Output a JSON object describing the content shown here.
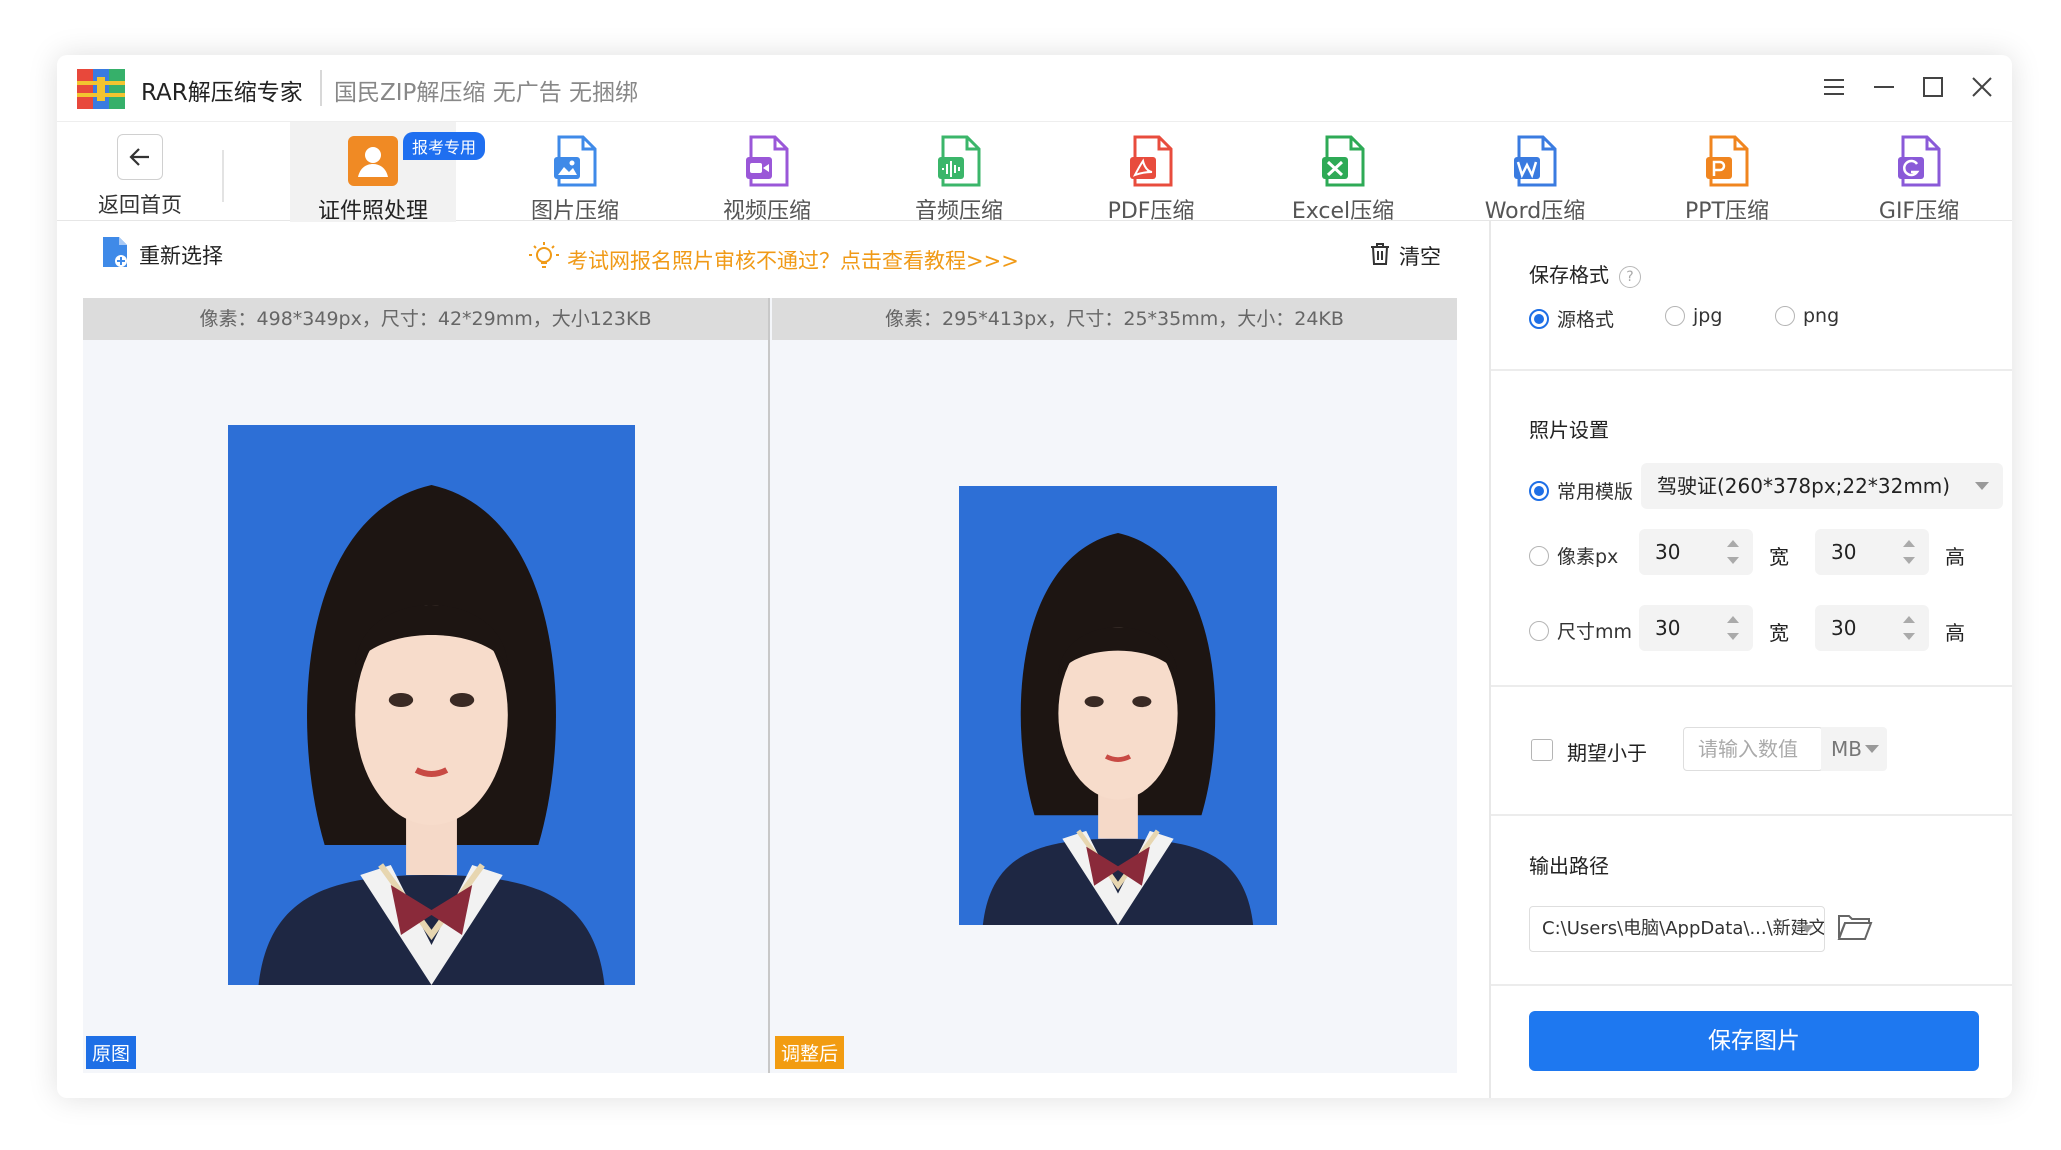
{
  "app": {
    "title": "RAR解压缩专家",
    "slogan": "国民ZIP解压缩  无广告 无捆绑"
  },
  "toolbar": {
    "back_label": "返回首页",
    "badge": "报考专用",
    "tools": [
      {
        "label": "证件照处理",
        "icon": "id-photo-icon",
        "color": "#f08a24",
        "active": true
      },
      {
        "label": "图片压缩",
        "icon": "image-file-icon",
        "color": "#3f8ae8"
      },
      {
        "label": "视频压缩",
        "icon": "video-file-icon",
        "color": "#9a57d8"
      },
      {
        "label": "音频压缩",
        "icon": "audio-file-icon",
        "color": "#3bb66a"
      },
      {
        "label": "PDF压缩",
        "icon": "pdf-file-icon",
        "color": "#e84c3d"
      },
      {
        "label": "Excel压缩",
        "icon": "excel-file-icon",
        "color": "#2eaa56"
      },
      {
        "label": "Word压缩",
        "icon": "word-file-icon",
        "color": "#3a7be0"
      },
      {
        "label": "PPT压缩",
        "icon": "ppt-file-icon",
        "color": "#f0851f"
      },
      {
        "label": "GIF压缩",
        "icon": "gif-file-icon",
        "color": "#8a5ad8"
      }
    ]
  },
  "actions": {
    "reselect": "重新选择",
    "tip": "考试网报名照片审核不通过？点击查看教程>>>",
    "clear": "清空"
  },
  "preview": {
    "original_info": "像素：498*349px，尺寸：42*29mm，大小123KB",
    "adjusted_info": "像素：295*413px，尺寸：25*35mm，大小：24KB",
    "original_tag": "原图",
    "adjusted_tag": "调整后"
  },
  "panel": {
    "format": {
      "title": "保存格式",
      "help": "?",
      "options": [
        "源格式",
        "jpg",
        "png"
      ],
      "selected": "源格式"
    },
    "photo": {
      "title": "照片设置",
      "template_label": "常用模版",
      "template_value": "驾驶证(260*378px;22*32mm)",
      "px_label": "像素px",
      "mm_label": "尺寸mm",
      "px_width": "30",
      "px_height": "30",
      "mm_width": "30",
      "mm_height": "30",
      "width_unit": "宽",
      "height_unit": "高"
    },
    "size_limit": {
      "label": "期望小于",
      "placeholder": "请输入数值",
      "unit": "MB"
    },
    "output": {
      "title": "输出路径",
      "path": "C:\\Users\\电脑\\AppData\\...\\新建文件夹"
    },
    "save_button": "保存图片"
  },
  "colors": {
    "accent": "#1e78f0",
    "photo_bg": "#2d6fd6",
    "tip": "#f09a17",
    "tag_orange": "#f29c11"
  }
}
